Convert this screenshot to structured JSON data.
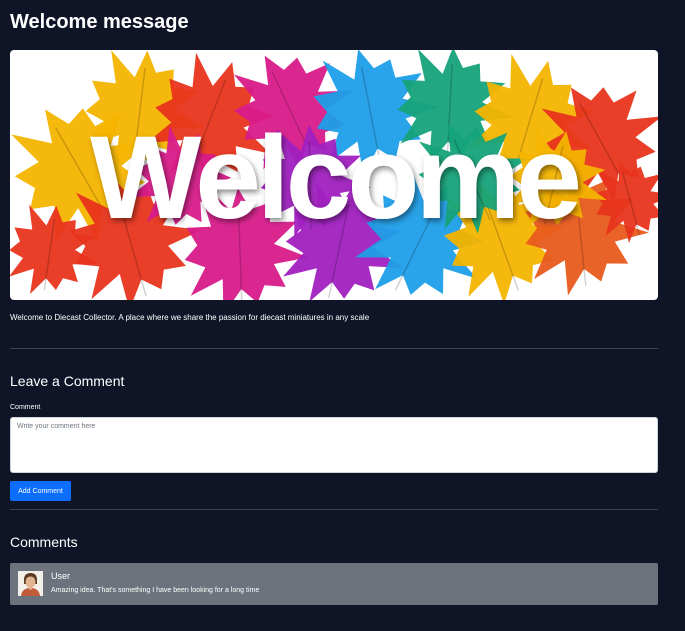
{
  "post": {
    "title": "Welcome message",
    "banner_word": "Welcome",
    "body": "Welcome to Diecast Collector. A place where we share the passion for diecast miniatures in any scale"
  },
  "comment_form": {
    "heading": "Leave a Comment",
    "label": "Comment",
    "placeholder": "Write your comment here",
    "submit_label": "Add Comment",
    "submit_color": "#0d6efd"
  },
  "comments": {
    "heading": "Comments",
    "items": [
      {
        "user": "User",
        "text": "Amazing idea. That's something I have been looking for a long time",
        "avatar": "user-avatar-icon"
      }
    ]
  },
  "colors": {
    "background": "#0f1527",
    "comment_card": "#6c737c",
    "divider": "#3c4355"
  },
  "banner_leaf_colors": [
    "#f4b400",
    "#e8341c",
    "#d81b8a",
    "#a020c0",
    "#1e9ee8",
    "#16a37a",
    "#e85a1c"
  ]
}
